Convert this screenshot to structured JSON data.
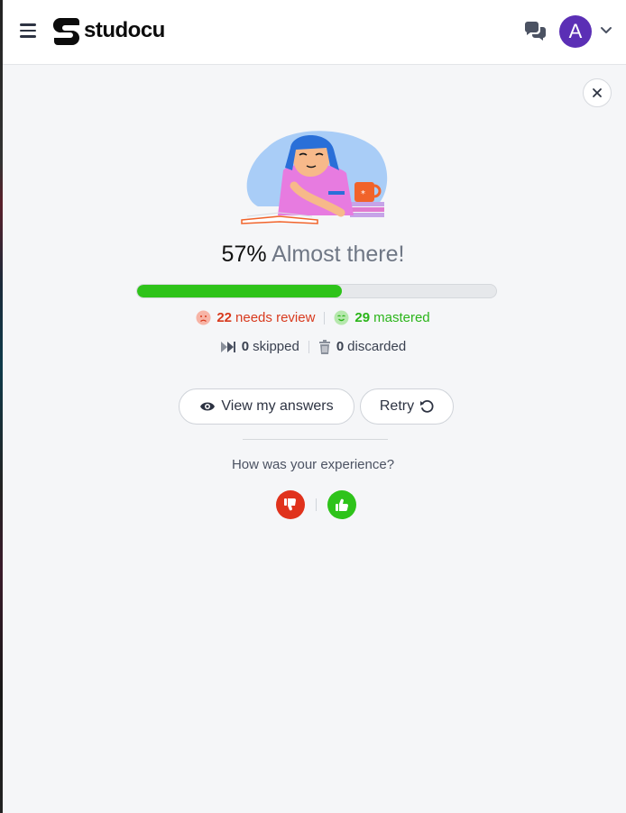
{
  "header": {
    "brand": "studocu",
    "avatar_letter": "A",
    "icons": [
      "hamburger-menu-icon",
      "studocu-logo-icon",
      "chat-icon",
      "chevron-down-icon"
    ]
  },
  "result": {
    "percent": "57%",
    "message": "Almost there!",
    "progress_fraction": 0.57,
    "needs_review_count": "22",
    "needs_review_label": "needs review",
    "mastered_count": "29",
    "mastered_label": "mastered",
    "skipped_count": "0",
    "skipped_label": "skipped",
    "discarded_count": "0",
    "discarded_label": "discarded"
  },
  "actions": {
    "view_answers_label": "View my answers",
    "retry_label": "Retry"
  },
  "feedback": {
    "question": "How was your experience?"
  },
  "colors": {
    "progress": "#2ec31a",
    "needs_review": "#d83a1e",
    "mastered": "#2bb51a",
    "avatar": "#5b2fb5",
    "thumbs_down": "#e0321c",
    "thumbs_up": "#2ec31a"
  }
}
